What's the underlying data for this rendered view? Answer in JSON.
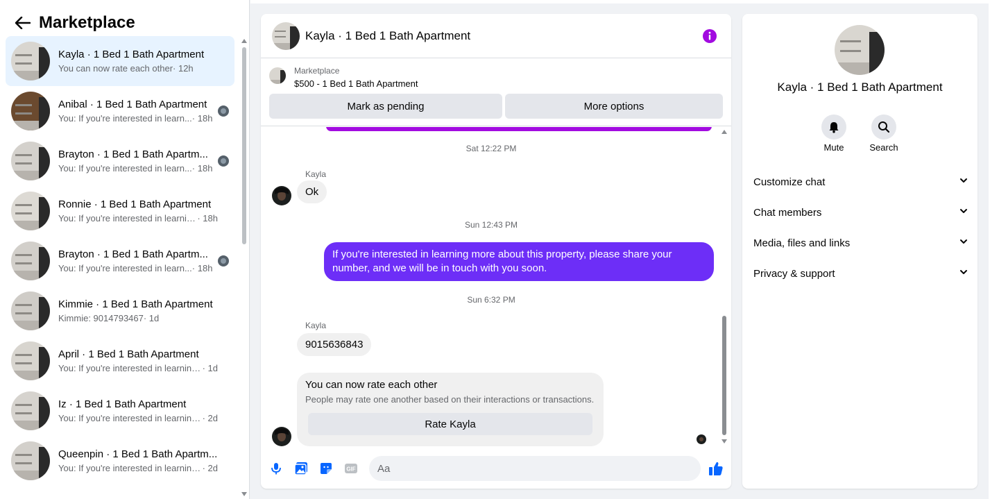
{
  "sidebar": {
    "title": "Marketplace",
    "conversations": [
      {
        "name": "Kayla · 1 Bed 1 Bath Apartment",
        "preview": "You can now rate each other",
        "time": "· 12h",
        "active": true,
        "mini": false
      },
      {
        "name": "Anibal · 1 Bed 1 Bath Apartment",
        "preview": "You: If you're interested in learn...",
        "time": " · 18h",
        "active": false,
        "mini": true
      },
      {
        "name": "Brayton · 1 Bed 1 Bath Apartm...",
        "preview": "You: If you're interested in learn...",
        "time": " · 18h",
        "active": false,
        "mini": true
      },
      {
        "name": "Ronnie · 1 Bed 1 Bath Apartment",
        "preview": "You: If you're interested in learnin...",
        "time": " · 18h",
        "active": false,
        "mini": false
      },
      {
        "name": "Brayton · 1 Bed 1 Bath Apartm...",
        "preview": "You: If you're interested in learn...",
        "time": " · 18h",
        "active": false,
        "mini": true
      },
      {
        "name": "Kimmie · 1 Bed 1 Bath Apartment",
        "preview": "Kimmie: 9014793467",
        "time": " · 1d",
        "active": false,
        "mini": false
      },
      {
        "name": "April · 1 Bed 1 Bath Apartment",
        "preview": "You: If you're interested in learning ...",
        "time": " · 1d",
        "active": false,
        "mini": false
      },
      {
        "name": "Iz · 1 Bed 1 Bath Apartment",
        "preview": "You: If you're interested in learning ...",
        "time": " · 2d",
        "active": false,
        "mini": false
      },
      {
        "name": "Queenpin · 1 Bed 1 Bath Apartm...",
        "preview": "You: If you're interested in learning ...",
        "time": " · 2d",
        "active": false,
        "mini": false
      }
    ]
  },
  "chat": {
    "title": "Kayla · 1 Bed 1 Bath Apartment",
    "listing": {
      "source": "Marketplace",
      "price_title": "$500 - 1 Bed 1 Bath Apartment",
      "pending_label": "Mark as pending",
      "more_label": "More options"
    },
    "messages": {
      "ts1": "Sat 12:22 PM",
      "sender1": "Kayla",
      "msg1": "Ok",
      "ts2": "Sun 12:43 PM",
      "msg2_line1": "If you're interested in learning more about this property, please share your",
      "msg2_line2": "number, and we will be in touch with you soon.",
      "ts3": "Sun 6:32 PM",
      "sender2": "Kayla",
      "msg3": "9015636843",
      "rate_title": "You can now rate each other",
      "rate_desc": "People may rate one another based on their interactions or transactions.",
      "rate_button": "Rate Kayla"
    },
    "composer": {
      "placeholder": "Aa"
    }
  },
  "details": {
    "name": "Kayla · 1 Bed 1 Bath Apartment",
    "mute_label": "Mute",
    "search_label": "Search",
    "sections": [
      "Customize chat",
      "Chat members",
      "Media, files and links",
      "Privacy & support"
    ]
  },
  "colors": {
    "accent": "#0866ff",
    "outgoing_bubble": "#6d2ef7",
    "info_icon": "#a20be0",
    "active_row": "#e7f3ff"
  }
}
